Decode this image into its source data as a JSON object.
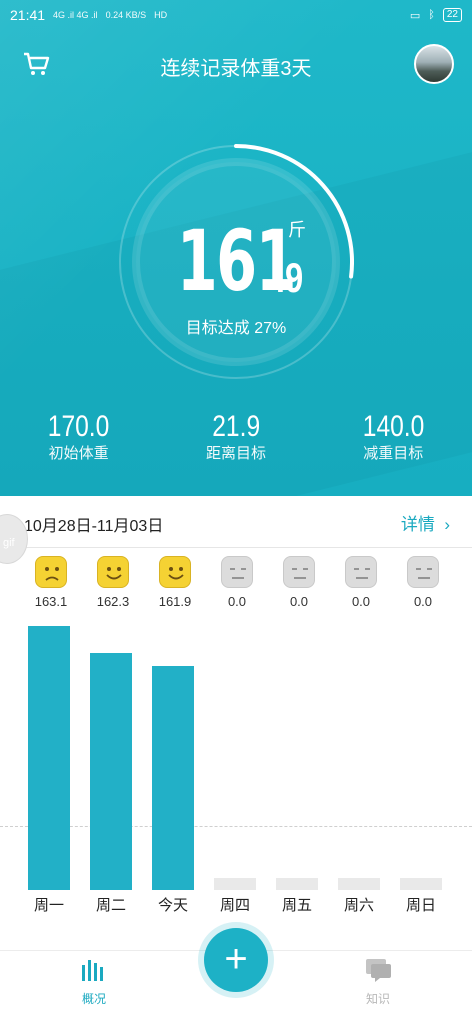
{
  "status": {
    "time": "21:41",
    "signal_text": "4G .il 4G .il",
    "net_speed": "0.24 KB/S",
    "hd": "HD",
    "battery": "22"
  },
  "header": {
    "title": "连续记录体重3天"
  },
  "weight": {
    "integer": "161",
    "decimal": ".9",
    "unit": "斤",
    "goal_text": "目标达成 27%",
    "goal_progress": 0.27
  },
  "stats": [
    {
      "value": "170.0",
      "label": "初始体重"
    },
    {
      "value": "21.9",
      "label": "距离目标"
    },
    {
      "value": "140.0",
      "label": "减重目标"
    }
  ],
  "week": {
    "range": "10月28日-11月03日",
    "detail_label": "详情",
    "gif_label": "gif"
  },
  "days": [
    {
      "label": "周一",
      "value": "163.1",
      "mood": "sad"
    },
    {
      "label": "周二",
      "value": "162.3",
      "mood": "happy"
    },
    {
      "label": "今天",
      "value": "161.9",
      "mood": "happy"
    },
    {
      "label": "周四",
      "value": "0.0",
      "mood": "none"
    },
    {
      "label": "周五",
      "value": "0.0",
      "mood": "none"
    },
    {
      "label": "周六",
      "value": "0.0",
      "mood": "none"
    },
    {
      "label": "周日",
      "value": "0.0",
      "mood": "none"
    }
  ],
  "chart_data": {
    "type": "bar",
    "categories": [
      "周一",
      "周二",
      "今天",
      "周四",
      "周五",
      "周六",
      "周日"
    ],
    "values": [
      163.1,
      162.3,
      161.9,
      0.0,
      0.0,
      0.0,
      0.0
    ],
    "title": "",
    "xlabel": "",
    "ylabel": "",
    "grid": false
  },
  "nav": {
    "left_label": "概况",
    "right_label": "知识",
    "add_symbol": "+"
  },
  "colors": {
    "accent": "#1db1c6",
    "bar": "#22b0c7",
    "mood_yellow": "#f5d233"
  }
}
